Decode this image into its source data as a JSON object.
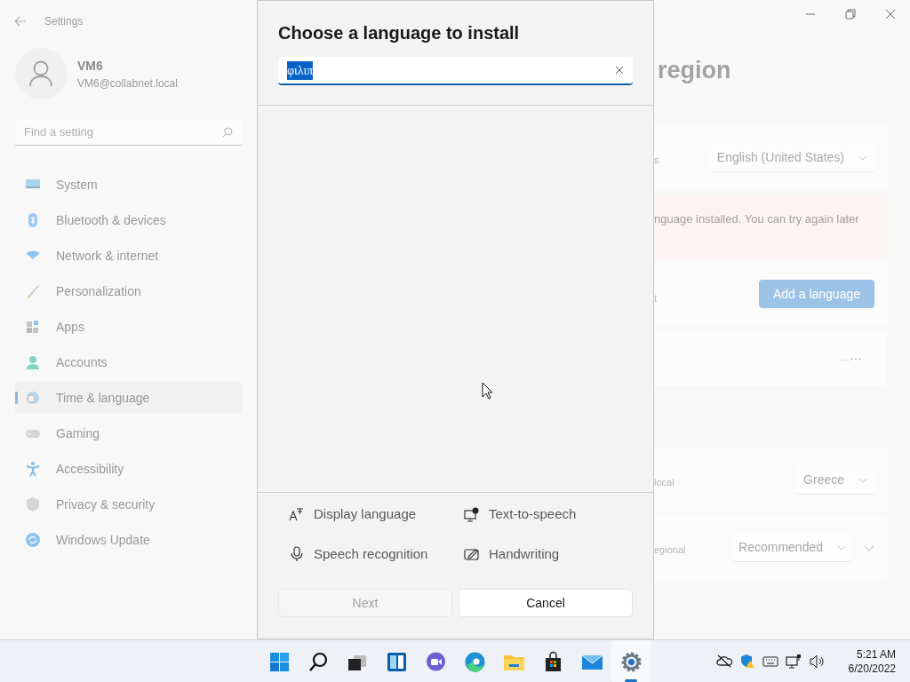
{
  "window": {
    "title": "Settings"
  },
  "user": {
    "name": "VM6",
    "email": "VM6@collabnet.local"
  },
  "search": {
    "placeholder": "Find a setting"
  },
  "nav": [
    {
      "label": "System",
      "selected": false
    },
    {
      "label": "Bluetooth & devices",
      "selected": false
    },
    {
      "label": "Network & internet",
      "selected": false
    },
    {
      "label": "Personalization",
      "selected": false
    },
    {
      "label": "Apps",
      "selected": false
    },
    {
      "label": "Accounts",
      "selected": false
    },
    {
      "label": "Time & language",
      "selected": true
    },
    {
      "label": "Gaming",
      "selected": false
    },
    {
      "label": "Accessibility",
      "selected": false
    },
    {
      "label": "Privacy & security",
      "selected": false
    },
    {
      "label": "Windows Update",
      "selected": false
    }
  ],
  "page": {
    "heading": "region",
    "cards": [
      {
        "kind": "dropdown",
        "label": "s",
        "value": "English (United States)"
      },
      {
        "kind": "error",
        "label": "nguage installed. You can try again later"
      },
      {
        "kind": "button",
        "label": "t",
        "button": "Add a language"
      },
      {
        "kind": "more",
        "label": "···"
      },
      {
        "kind": "gap"
      },
      {
        "kind": "dropdown",
        "label": "local",
        "value": "Greece",
        "expand": false
      },
      {
        "kind": "dropdown",
        "label": "egional",
        "value": "Recommended",
        "expand": true
      }
    ]
  },
  "dialog": {
    "title": "Choose a language to install",
    "search_value": "φιλιπ",
    "text_selected": true,
    "features": [
      {
        "label": "Display language"
      },
      {
        "label": "Text-to-speech"
      },
      {
        "label": "Speech recognition"
      },
      {
        "label": "Handwriting"
      }
    ],
    "buttons": [
      {
        "label": "Next",
        "disabled": true
      },
      {
        "label": "Cancel",
        "disabled": false
      }
    ]
  },
  "taskbar": {
    "apps": [
      {
        "active": false
      },
      {
        "active": false
      },
      {
        "active": false
      },
      {
        "active": false
      },
      {
        "active": false
      },
      {
        "active": false
      },
      {
        "active": false
      },
      {
        "active": false
      },
      {
        "active": false
      },
      {
        "active": true
      }
    ],
    "time": "5:21 AM",
    "date": "6/20/2022"
  }
}
